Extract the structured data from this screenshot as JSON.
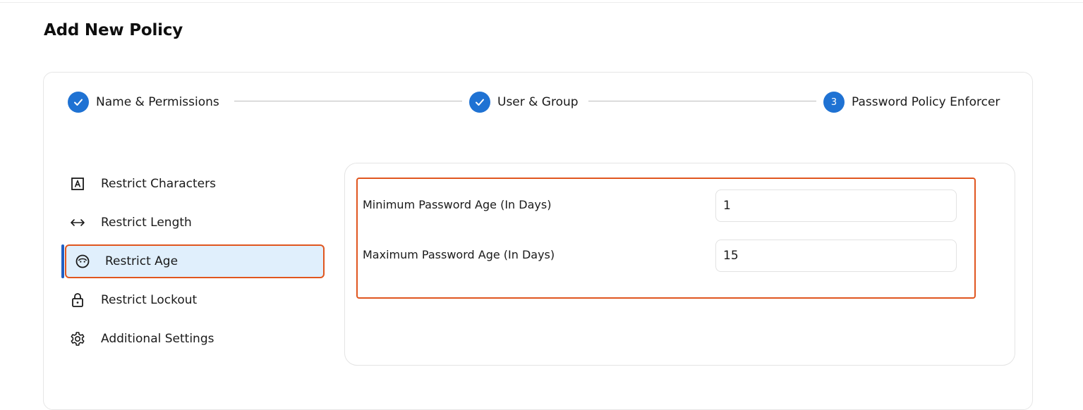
{
  "page": {
    "title": "Add New Policy"
  },
  "stepper": {
    "steps": [
      {
        "label": "Name & Permissions",
        "state": "completed"
      },
      {
        "label": "User & Group",
        "state": "completed"
      },
      {
        "label": "Password Policy Enforcer",
        "state": "current",
        "number": "3"
      }
    ],
    "accent_color": "#1f72d3"
  },
  "sidebar": {
    "items": [
      {
        "label": "Restrict Characters",
        "icon": "letter-a-box-icon"
      },
      {
        "label": "Restrict Length",
        "icon": "horizontal-arrows-icon"
      },
      {
        "label": "Restrict Age",
        "icon": "face-icon",
        "selected": true
      },
      {
        "label": "Restrict Lockout",
        "icon": "lock-icon"
      },
      {
        "label": "Additional Settings",
        "icon": "gear-icon"
      }
    ],
    "selected_bg": "#e0effc",
    "selected_border": "#e0561f"
  },
  "form": {
    "min_age": {
      "label": "Minimum Password Age (In Days)",
      "value": "1"
    },
    "max_age": {
      "label": "Maximum Password Age (In Days)",
      "value": "15"
    }
  }
}
